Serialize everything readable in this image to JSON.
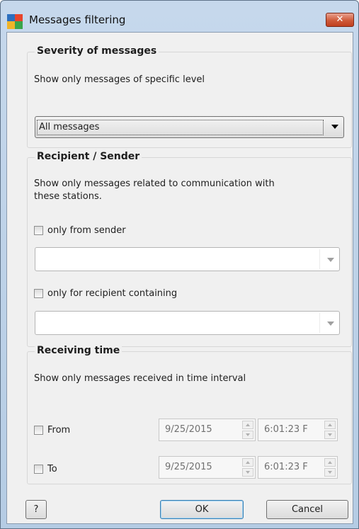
{
  "window": {
    "title": "Messages filtering",
    "close_label": "✕"
  },
  "severity": {
    "heading": "Severity of messages",
    "description": "Show only messages of specific level",
    "selected": "All messages"
  },
  "recipient": {
    "heading": "Recipient / Sender",
    "description_line1": "Show only messages related to communication with",
    "description_line2": "these stations.",
    "sender_label": "only from sender",
    "sender_value": "",
    "recipient_label": "only for recipient containing",
    "recipient_value": ""
  },
  "time": {
    "heading": "Receiving time",
    "description": "Show only messages received in time interval",
    "from_label": "From",
    "from_date": "9/25/2015",
    "from_time": "6:01:23 F",
    "to_label": "To",
    "to_date": "9/25/2015",
    "to_time": "6:01:23 F"
  },
  "buttons": {
    "help": "?",
    "ok": "OK",
    "cancel": "Cancel"
  },
  "icons": {
    "app": "avg-logo-icon",
    "close": "close-icon",
    "dropdown": "chevron-down-icon"
  }
}
